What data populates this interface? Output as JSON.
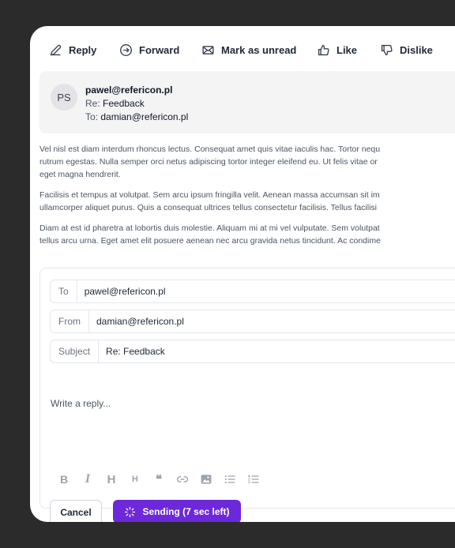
{
  "toolbar": {
    "reply": "Reply",
    "forward": "Forward",
    "mark_unread": "Mark as unread",
    "like": "Like",
    "dislike": "Dislike"
  },
  "message": {
    "avatar_initials": "PS",
    "from": "pawel@refericon.pl",
    "subject_prefix": "Re:",
    "subject": "Feedback",
    "to_prefix": "To:",
    "to": "damian@refericon.pl",
    "paragraphs": [
      "Vel nisl est diam interdum rhoncus lectus. Consequat amet quis vitae iaculis hac. Tortor nequ",
      "rutrum egestas. Nulla semper orci netus adipiscing tortor integer eleifend eu. Ut felis vitae or",
      "eget magna hendrerit.",
      "Facilisis et tempus at volutpat. Sem arcu ipsum fringilla velit. Aenean massa accumsan sit im",
      "ullamcorper aliquet purus. Quis a consequat ultrices tellus consectetur facilisis. Tellus facilisi",
      "Diam at est id pharetra at lobortis duis molestie. Aliquam mi at mi vel vulputate. Sem volutpat",
      "tellus arcu urna. Eget amet elit posuere aenean nec arcu gravida netus tincidunt. Ac condime"
    ]
  },
  "reply_form": {
    "to_label": "To",
    "to_value": "pawel@refericon.pl",
    "from_label": "From",
    "from_value": "damian@refericon.pl",
    "subject_label": "Subject",
    "subject_value": "Re: Feedback",
    "placeholder": "Write a reply...",
    "cancel_label": "Cancel",
    "send_label": "Sending (7 sec left)",
    "format_icons": [
      "bold-icon",
      "italic-icon",
      "heading-icon",
      "subheading-icon",
      "quote-icon",
      "link-icon",
      "image-icon",
      "bullet-list-icon",
      "numbered-list-icon"
    ]
  },
  "colors": {
    "accent": "#6d28d9",
    "background": "#2b2b2b"
  }
}
